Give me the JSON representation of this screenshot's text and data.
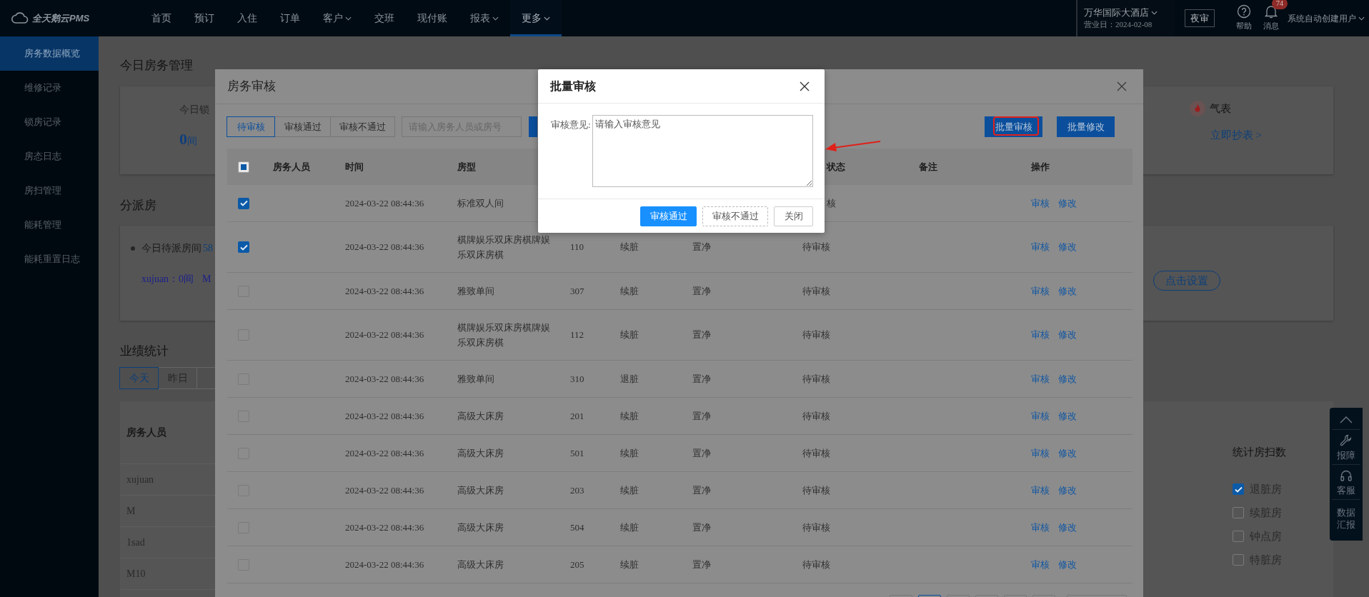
{
  "top_nav": {
    "logo": "全天鹅云PMS",
    "items": [
      {
        "label": "首页",
        "dropdown": false,
        "selected": false
      },
      {
        "label": "预订",
        "dropdown": false,
        "selected": false
      },
      {
        "label": "入住",
        "dropdown": false,
        "selected": false
      },
      {
        "label": "订单",
        "dropdown": false,
        "selected": false
      },
      {
        "label": "客户",
        "dropdown": true,
        "selected": false
      },
      {
        "label": "交班",
        "dropdown": false,
        "selected": false
      },
      {
        "label": "现付账",
        "dropdown": false,
        "selected": false
      },
      {
        "label": "报表",
        "dropdown": true,
        "selected": false
      },
      {
        "label": "更多",
        "dropdown": true,
        "selected": true
      }
    ],
    "hotel": "万华国际大酒店",
    "business_date": "营业日：2024-02-08",
    "night_audit": "夜审",
    "help": "帮助",
    "messages": "消息",
    "message_count": "74",
    "user": "系统自动创建用户"
  },
  "sidebar": {
    "items": [
      {
        "label": "房务数据概览",
        "selected": true
      },
      {
        "label": "维修记录",
        "selected": false
      },
      {
        "label": "锁房记录",
        "selected": false
      },
      {
        "label": "房态日志",
        "selected": false
      },
      {
        "label": "房扫管理",
        "selected": false
      },
      {
        "label": "能耗管理",
        "selected": false
      },
      {
        "label": "能耗重置日志",
        "selected": false
      }
    ]
  },
  "dashboard": {
    "housekeeping": {
      "title": "今日房务管理",
      "lock_label": "今日锁",
      "lock_count": "0",
      "lock_unit": "间",
      "meter": "气表",
      "meter_link": "立即抄表 >"
    },
    "assign": {
      "title": "分派房",
      "pending_label": "今日待派房间",
      "pending_count": "58",
      "assignees": [
        "xujuan：0间",
        "M"
      ],
      "settings_button": "点击设置"
    },
    "stats": {
      "title": "业绩统计",
      "tabs": [
        {
          "label": "今天",
          "selected": true
        },
        {
          "label": "昨日",
          "selected": false
        },
        {
          "selected": false
        }
      ],
      "column": "房务人员",
      "rows": [
        "xujuan",
        "M",
        "1sad",
        "M10"
      ],
      "count_title": "统计房扫数",
      "count_options": [
        {
          "label": "退脏房",
          "checked": true
        },
        {
          "label": "续脏房",
          "checked": false
        },
        {
          "label": "钟点房",
          "checked": false
        },
        {
          "label": "特脏房",
          "checked": false
        }
      ]
    }
  },
  "float_toolbar": [
    {
      "kind": "top"
    },
    {
      "kind": "repair",
      "label": "报障"
    },
    {
      "kind": "service",
      "label": "客服"
    },
    {
      "kind": "report",
      "label": "数据汇报"
    }
  ],
  "audit_dialog": {
    "title": "房务审核",
    "tabs": [
      {
        "label": "待审核",
        "selected": true
      },
      {
        "label": "审核通过",
        "selected": false
      },
      {
        "label": "审核不通过",
        "selected": false
      }
    ],
    "search_placeholder": "请输入房务人员或房号",
    "actions": [
      "批量审核",
      "批量修改"
    ],
    "header": {
      "select_all": {
        "indeterminate": true
      },
      "staff": "房务人员",
      "time": "时间",
      "room_type": "房型",
      "audit_status": "状态",
      "audit_status_covered": true,
      "remark": "备注",
      "actions": "操作"
    },
    "rows": [
      {
        "checked": true,
        "covered": true,
        "time": "2024-03-22 08:44:36",
        "room_type": "标准双人间",
        "audit_status": "核",
        "actions": [
          "审核",
          "修改"
        ]
      },
      {
        "checked": true,
        "covered": false,
        "time": "2024-03-22 08:44:36",
        "room_type": "棋牌娱乐双床房棋牌娱乐双床房棋",
        "room": "110",
        "clean_status": "续脏",
        "ready_status": "置净",
        "audit_status": "待审核",
        "actions": [
          "审核",
          "修改"
        ]
      },
      {
        "checked": false,
        "covered": false,
        "time": "2024-03-22 08:44:36",
        "room_type": "雅致单间",
        "room": "307",
        "clean_status": "续脏",
        "ready_status": "置净",
        "audit_status": "待审核",
        "actions": [
          "审核",
          "修改"
        ]
      },
      {
        "checked": false,
        "covered": false,
        "time": "2024-03-22 08:44:36",
        "room_type": "棋牌娱乐双床房棋牌娱乐双床房棋",
        "room": "112",
        "clean_status": "续脏",
        "ready_status": "置净",
        "audit_status": "待审核",
        "actions": [
          "审核",
          "修改"
        ]
      },
      {
        "checked": false,
        "covered": false,
        "time": "2024-03-22 08:44:36",
        "room_type": "雅致单间",
        "room": "310",
        "clean_status": "退脏",
        "ready_status": "置净",
        "audit_status": "待审核",
        "actions": [
          "审核",
          "修改"
        ]
      },
      {
        "checked": false,
        "covered": false,
        "time": "2024-03-22 08:44:36",
        "room_type": "高级大床房",
        "room": "201",
        "clean_status": "续脏",
        "ready_status": "置净",
        "audit_status": "待审核",
        "actions": [
          "审核",
          "修改"
        ]
      },
      {
        "checked": false,
        "covered": false,
        "time": "2024-03-22 08:44:36",
        "room_type": "高级大床房",
        "room": "501",
        "clean_status": "续脏",
        "ready_status": "置净",
        "audit_status": "待审核",
        "actions": [
          "审核",
          "修改"
        ]
      },
      {
        "checked": false,
        "covered": false,
        "time": "2024-03-22 08:44:36",
        "room_type": "高级大床房",
        "room": "203",
        "clean_status": "续脏",
        "ready_status": "置净",
        "audit_status": "待审核",
        "actions": [
          "审核",
          "修改"
        ]
      },
      {
        "checked": false,
        "covered": false,
        "time": "2024-03-22 08:44:36",
        "room_type": "高级大床房",
        "room": "504",
        "clean_status": "续脏",
        "ready_status": "置净",
        "audit_status": "待审核",
        "actions": [
          "审核",
          "修改"
        ]
      },
      {
        "checked": false,
        "covered": false,
        "time": "2024-03-22 08:44:36",
        "room_type": "高级大床房",
        "room": "205",
        "clean_status": "续脏",
        "ready_status": "置净",
        "audit_status": "待审核",
        "actions": [
          "审核",
          "修改"
        ]
      }
    ],
    "pagination": [
      {
        "selected": false
      },
      {
        "selected": true
      },
      {
        "selected": false
      },
      {
        "selected": false
      },
      {
        "selected": false
      },
      {
        "selected": false
      }
    ]
  },
  "batch_dialog": {
    "title": "批量审核",
    "label": "审核意见:",
    "placeholder": "请输入审核意见",
    "buttons": [
      {
        "kind": "primary",
        "label": "审核通过"
      },
      {
        "kind": "dashed",
        "label": "审核不通过"
      },
      {
        "kind": "default",
        "label": "关闭"
      }
    ]
  }
}
